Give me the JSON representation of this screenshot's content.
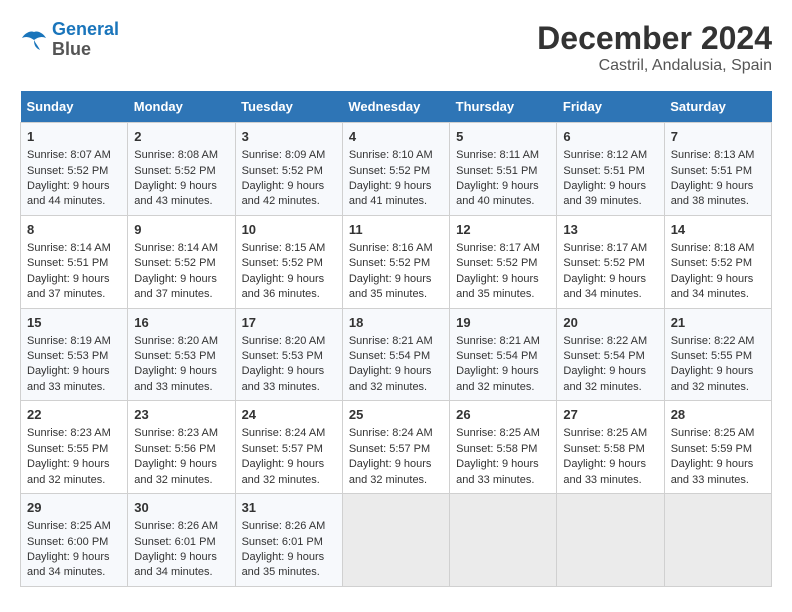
{
  "header": {
    "logo_line1": "General",
    "logo_line2": "Blue",
    "month": "December 2024",
    "location": "Castril, Andalusia, Spain"
  },
  "days_of_week": [
    "Sunday",
    "Monday",
    "Tuesday",
    "Wednesday",
    "Thursday",
    "Friday",
    "Saturday"
  ],
  "weeks": [
    [
      {
        "day": "1",
        "sunrise": "Sunrise: 8:07 AM",
        "sunset": "Sunset: 5:52 PM",
        "daylight": "Daylight: 9 hours and 44 minutes."
      },
      {
        "day": "2",
        "sunrise": "Sunrise: 8:08 AM",
        "sunset": "Sunset: 5:52 PM",
        "daylight": "Daylight: 9 hours and 43 minutes."
      },
      {
        "day": "3",
        "sunrise": "Sunrise: 8:09 AM",
        "sunset": "Sunset: 5:52 PM",
        "daylight": "Daylight: 9 hours and 42 minutes."
      },
      {
        "day": "4",
        "sunrise": "Sunrise: 8:10 AM",
        "sunset": "Sunset: 5:52 PM",
        "daylight": "Daylight: 9 hours and 41 minutes."
      },
      {
        "day": "5",
        "sunrise": "Sunrise: 8:11 AM",
        "sunset": "Sunset: 5:51 PM",
        "daylight": "Daylight: 9 hours and 40 minutes."
      },
      {
        "day": "6",
        "sunrise": "Sunrise: 8:12 AM",
        "sunset": "Sunset: 5:51 PM",
        "daylight": "Daylight: 9 hours and 39 minutes."
      },
      {
        "day": "7",
        "sunrise": "Sunrise: 8:13 AM",
        "sunset": "Sunset: 5:51 PM",
        "daylight": "Daylight: 9 hours and 38 minutes."
      }
    ],
    [
      {
        "day": "8",
        "sunrise": "Sunrise: 8:14 AM",
        "sunset": "Sunset: 5:51 PM",
        "daylight": "Daylight: 9 hours and 37 minutes."
      },
      {
        "day": "9",
        "sunrise": "Sunrise: 8:14 AM",
        "sunset": "Sunset: 5:52 PM",
        "daylight": "Daylight: 9 hours and 37 minutes."
      },
      {
        "day": "10",
        "sunrise": "Sunrise: 8:15 AM",
        "sunset": "Sunset: 5:52 PM",
        "daylight": "Daylight: 9 hours and 36 minutes."
      },
      {
        "day": "11",
        "sunrise": "Sunrise: 8:16 AM",
        "sunset": "Sunset: 5:52 PM",
        "daylight": "Daylight: 9 hours and 35 minutes."
      },
      {
        "day": "12",
        "sunrise": "Sunrise: 8:17 AM",
        "sunset": "Sunset: 5:52 PM",
        "daylight": "Daylight: 9 hours and 35 minutes."
      },
      {
        "day": "13",
        "sunrise": "Sunrise: 8:17 AM",
        "sunset": "Sunset: 5:52 PM",
        "daylight": "Daylight: 9 hours and 34 minutes."
      },
      {
        "day": "14",
        "sunrise": "Sunrise: 8:18 AM",
        "sunset": "Sunset: 5:52 PM",
        "daylight": "Daylight: 9 hours and 34 minutes."
      }
    ],
    [
      {
        "day": "15",
        "sunrise": "Sunrise: 8:19 AM",
        "sunset": "Sunset: 5:53 PM",
        "daylight": "Daylight: 9 hours and 33 minutes."
      },
      {
        "day": "16",
        "sunrise": "Sunrise: 8:20 AM",
        "sunset": "Sunset: 5:53 PM",
        "daylight": "Daylight: 9 hours and 33 minutes."
      },
      {
        "day": "17",
        "sunrise": "Sunrise: 8:20 AM",
        "sunset": "Sunset: 5:53 PM",
        "daylight": "Daylight: 9 hours and 33 minutes."
      },
      {
        "day": "18",
        "sunrise": "Sunrise: 8:21 AM",
        "sunset": "Sunset: 5:54 PM",
        "daylight": "Daylight: 9 hours and 32 minutes."
      },
      {
        "day": "19",
        "sunrise": "Sunrise: 8:21 AM",
        "sunset": "Sunset: 5:54 PM",
        "daylight": "Daylight: 9 hours and 32 minutes."
      },
      {
        "day": "20",
        "sunrise": "Sunrise: 8:22 AM",
        "sunset": "Sunset: 5:54 PM",
        "daylight": "Daylight: 9 hours and 32 minutes."
      },
      {
        "day": "21",
        "sunrise": "Sunrise: 8:22 AM",
        "sunset": "Sunset: 5:55 PM",
        "daylight": "Daylight: 9 hours and 32 minutes."
      }
    ],
    [
      {
        "day": "22",
        "sunrise": "Sunrise: 8:23 AM",
        "sunset": "Sunset: 5:55 PM",
        "daylight": "Daylight: 9 hours and 32 minutes."
      },
      {
        "day": "23",
        "sunrise": "Sunrise: 8:23 AM",
        "sunset": "Sunset: 5:56 PM",
        "daylight": "Daylight: 9 hours and 32 minutes."
      },
      {
        "day": "24",
        "sunrise": "Sunrise: 8:24 AM",
        "sunset": "Sunset: 5:57 PM",
        "daylight": "Daylight: 9 hours and 32 minutes."
      },
      {
        "day": "25",
        "sunrise": "Sunrise: 8:24 AM",
        "sunset": "Sunset: 5:57 PM",
        "daylight": "Daylight: 9 hours and 32 minutes."
      },
      {
        "day": "26",
        "sunrise": "Sunrise: 8:25 AM",
        "sunset": "Sunset: 5:58 PM",
        "daylight": "Daylight: 9 hours and 33 minutes."
      },
      {
        "day": "27",
        "sunrise": "Sunrise: 8:25 AM",
        "sunset": "Sunset: 5:58 PM",
        "daylight": "Daylight: 9 hours and 33 minutes."
      },
      {
        "day": "28",
        "sunrise": "Sunrise: 8:25 AM",
        "sunset": "Sunset: 5:59 PM",
        "daylight": "Daylight: 9 hours and 33 minutes."
      }
    ],
    [
      {
        "day": "29",
        "sunrise": "Sunrise: 8:25 AM",
        "sunset": "Sunset: 6:00 PM",
        "daylight": "Daylight: 9 hours and 34 minutes."
      },
      {
        "day": "30",
        "sunrise": "Sunrise: 8:26 AM",
        "sunset": "Sunset: 6:01 PM",
        "daylight": "Daylight: 9 hours and 34 minutes."
      },
      {
        "day": "31",
        "sunrise": "Sunrise: 8:26 AM",
        "sunset": "Sunset: 6:01 PM",
        "daylight": "Daylight: 9 hours and 35 minutes."
      },
      null,
      null,
      null,
      null
    ]
  ]
}
